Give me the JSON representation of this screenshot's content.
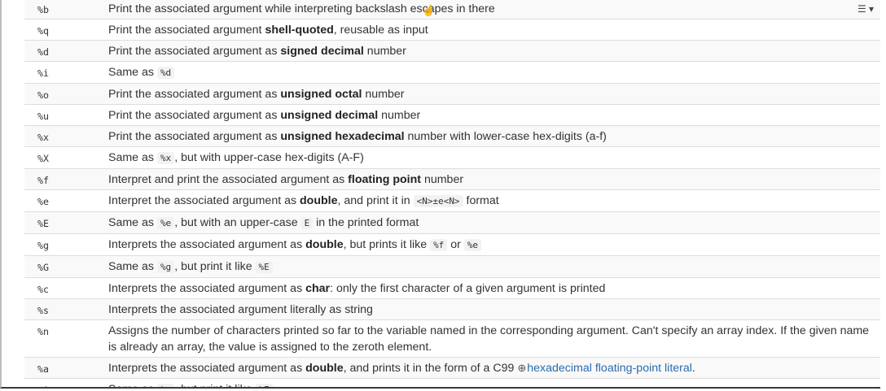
{
  "rows": [
    {
      "key": "%b",
      "parts": [
        {
          "t": "Print the associated argument while interpreting backslash escapes in there"
        }
      ]
    },
    {
      "key": "%q",
      "parts": [
        {
          "t": "Print the associated argument "
        },
        {
          "b": "shell-quoted"
        },
        {
          "t": ", reusable as input"
        }
      ]
    },
    {
      "key": "%d",
      "parts": [
        {
          "t": "Print the associated argument as "
        },
        {
          "b": "signed decimal"
        },
        {
          "t": " number"
        }
      ]
    },
    {
      "key": "%i",
      "parts": [
        {
          "t": "Same as "
        },
        {
          "c": "%d"
        }
      ]
    },
    {
      "key": "%o",
      "parts": [
        {
          "t": "Print the associated argument as "
        },
        {
          "b": "unsigned octal"
        },
        {
          "t": " number"
        }
      ]
    },
    {
      "key": "%u",
      "parts": [
        {
          "t": "Print the associated argument as "
        },
        {
          "b": "unsigned decimal"
        },
        {
          "t": " number"
        }
      ]
    },
    {
      "key": "%x",
      "parts": [
        {
          "t": "Print the associated argument as "
        },
        {
          "b": "unsigned hexadecimal"
        },
        {
          "t": " number with lower-case hex-digits (a-f)"
        }
      ]
    },
    {
      "key": "%X",
      "parts": [
        {
          "t": "Same as "
        },
        {
          "c": "%x"
        },
        {
          "t": ", but with upper-case hex-digits (A-F)"
        }
      ]
    },
    {
      "key": "%f",
      "parts": [
        {
          "t": "Interpret and print the associated argument as "
        },
        {
          "b": "floating point"
        },
        {
          "t": " number"
        }
      ]
    },
    {
      "key": "%e",
      "parts": [
        {
          "t": "Interpret the associated argument as "
        },
        {
          "b": "double"
        },
        {
          "t": ", and print it in "
        },
        {
          "c": "<N>±e<N>"
        },
        {
          "t": " format"
        }
      ]
    },
    {
      "key": "%E",
      "parts": [
        {
          "t": "Same as "
        },
        {
          "c": "%e"
        },
        {
          "t": ", but with an upper-case "
        },
        {
          "c": "E"
        },
        {
          "t": " in the printed format"
        }
      ]
    },
    {
      "key": "%g",
      "parts": [
        {
          "t": "Interprets the associated argument as "
        },
        {
          "b": "double"
        },
        {
          "t": ", but prints it like "
        },
        {
          "c": "%f"
        },
        {
          "t": " or "
        },
        {
          "c": "%e"
        }
      ]
    },
    {
      "key": "%G",
      "parts": [
        {
          "t": "Same as "
        },
        {
          "c": "%g"
        },
        {
          "t": ", but print it like "
        },
        {
          "c": "%E"
        }
      ]
    },
    {
      "key": "%c",
      "parts": [
        {
          "t": "Interprets the associated argument as "
        },
        {
          "b": "char"
        },
        {
          "t": ": only the first character of a given argument is printed"
        }
      ]
    },
    {
      "key": "%s",
      "parts": [
        {
          "t": "Interprets the associated argument literally as string"
        }
      ]
    },
    {
      "key": "%n",
      "parts": [
        {
          "t": "Assigns the number of characters printed so far to the variable named in the corresponding argument. Can't specify an array index. If the given name is already an array, the value is assigned to the zeroth element."
        }
      ]
    },
    {
      "key": "%a",
      "parts": [
        {
          "t": "Interprets the associated argument as "
        },
        {
          "b": "double"
        },
        {
          "t": ", and prints it in the form of a C99 "
        },
        {
          "link": "hexadecimal floating-point literal"
        },
        {
          "t": "."
        }
      ]
    },
    {
      "key": "%A",
      "parts": [
        {
          "t": "Same as "
        },
        {
          "c": "%a"
        },
        {
          "t": ", but print it like "
        },
        {
          "c": "%E"
        }
      ]
    }
  ],
  "icons": {
    "toc": "list-menu-icon",
    "external": "external-link-icon",
    "cursor": "mouse-cursor-icon"
  }
}
